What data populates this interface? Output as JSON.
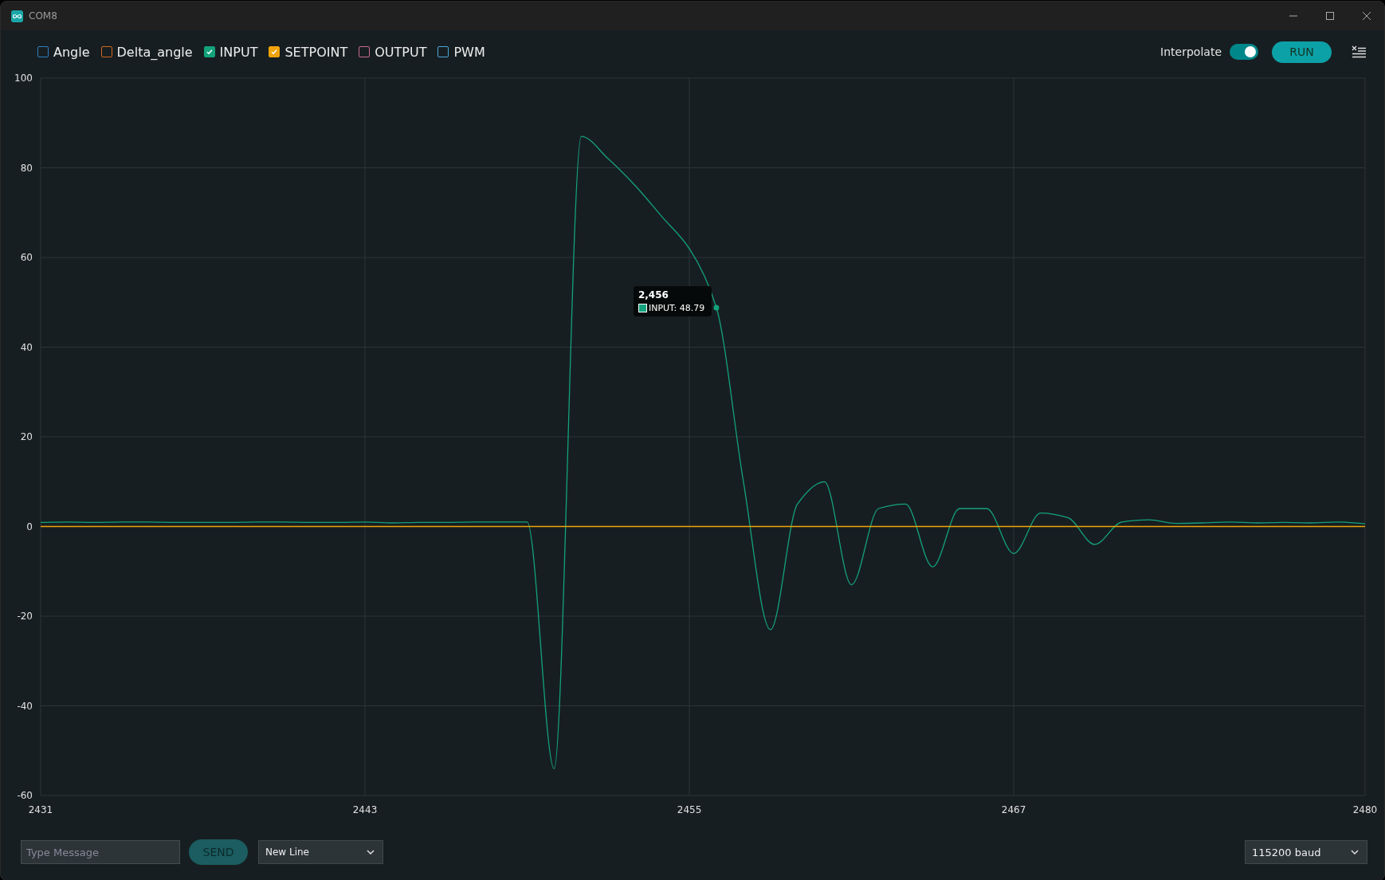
{
  "window": {
    "title": "COM8"
  },
  "legend": [
    {
      "checked": false
    },
    {
      "checked": false
    },
    {
      "checked": true
    },
    {
      "checked": true
    },
    {
      "checked": false
    },
    {
      "checked": false
    }
  ],
  "interpolate": {
    "label": "Interpolate",
    "on": true
  },
  "run_button": "RUN",
  "chart_data": {
    "type": "line",
    "grid": true,
    "x": [
      2431,
      2432,
      2433,
      2434,
      2435,
      2436,
      2437,
      2438,
      2439,
      2440,
      2441,
      2442,
      2443,
      2444,
      2445,
      2446,
      2447,
      2448,
      2449,
      2450,
      2451,
      2452,
      2453,
      2454,
      2455,
      2456,
      2457,
      2458,
      2459,
      2460,
      2461,
      2462,
      2463,
      2464,
      2465,
      2466,
      2467,
      2468,
      2469,
      2470,
      2471,
      2472,
      2473,
      2474,
      2475,
      2476,
      2477,
      2478,
      2479,
      2480
    ],
    "series": [
      {
        "name": "Angle",
        "color": "#2f7fc1",
        "values": [
          null,
          null,
          null,
          null,
          null,
          null,
          null,
          null,
          null,
          null,
          null,
          null,
          null,
          null,
          null,
          null,
          null,
          null,
          null,
          null,
          null,
          null,
          null,
          null,
          null,
          null,
          null,
          null,
          null,
          null,
          null,
          null,
          null,
          null,
          null,
          null,
          null,
          null,
          null,
          null,
          null,
          null,
          null,
          null,
          null,
          null,
          null,
          null,
          null,
          null
        ]
      },
      {
        "name": "Delta_angle",
        "color": "#d0661c",
        "values": [
          null,
          null,
          null,
          null,
          null,
          null,
          null,
          null,
          null,
          null,
          null,
          null,
          null,
          null,
          null,
          null,
          null,
          null,
          null,
          null,
          null,
          null,
          null,
          null,
          null,
          null,
          null,
          null,
          null,
          null,
          null,
          null,
          null,
          null,
          null,
          null,
          null,
          null,
          null,
          null,
          null,
          null,
          null,
          null,
          null,
          null,
          null,
          null,
          null,
          null
        ]
      },
      {
        "name": "INPUT",
        "color": "#13a27c",
        "values": [
          0.9,
          1.0,
          0.9,
          1.0,
          1.0,
          0.9,
          0.9,
          0.9,
          1.0,
          1.0,
          0.9,
          0.9,
          1.0,
          0.8,
          0.9,
          0.9,
          1.0,
          1.0,
          1.0,
          -54,
          87,
          82,
          76,
          69,
          62,
          48.8,
          10,
          -23,
          5,
          10,
          -13,
          4,
          5,
          -9,
          4,
          4,
          -6,
          3,
          2,
          -4,
          1,
          1.5,
          0.7,
          0.8,
          1.0,
          0.8,
          0.9,
          0.8,
          1.0,
          0.6
        ]
      },
      {
        "name": "SETPOINT",
        "color": "#f0a30a",
        "values": [
          0,
          0,
          0,
          0,
          0,
          0,
          0,
          0,
          0,
          0,
          0,
          0,
          0,
          0,
          0,
          0,
          0,
          0,
          0,
          0,
          0,
          0,
          0,
          0,
          0,
          0,
          0,
          0,
          0,
          0,
          0,
          0,
          0,
          0,
          0,
          0,
          0,
          0,
          0,
          0,
          0,
          0,
          0,
          0,
          0,
          0,
          0,
          0,
          0,
          0
        ]
      },
      {
        "name": "OUTPUT",
        "color": "#c76b8f",
        "values": [
          null,
          null,
          null,
          null,
          null,
          null,
          null,
          null,
          null,
          null,
          null,
          null,
          null,
          null,
          null,
          null,
          null,
          null,
          null,
          null,
          null,
          null,
          null,
          null,
          null,
          null,
          null,
          null,
          null,
          null,
          null,
          null,
          null,
          null,
          null,
          null,
          null,
          null,
          null,
          null,
          null,
          null,
          null,
          null,
          null,
          null,
          null,
          null,
          null,
          null
        ]
      },
      {
        "name": "PWM",
        "color": "#4aa6d8",
        "values": [
          null,
          null,
          null,
          null,
          null,
          null,
          null,
          null,
          null,
          null,
          null,
          null,
          null,
          null,
          null,
          null,
          null,
          null,
          null,
          null,
          null,
          null,
          null,
          null,
          null,
          null,
          null,
          null,
          null,
          null,
          null,
          null,
          null,
          null,
          null,
          null,
          null,
          null,
          null,
          null,
          null,
          null,
          null,
          null,
          null,
          null,
          null,
          null,
          null,
          null
        ]
      }
    ],
    "xlim": [
      2431,
      2480
    ],
    "ylim": [
      -60,
      100
    ],
    "xticks": [
      {
        "value": 2431,
        "label": "2431"
      },
      {
        "value": 2443,
        "label": "2443"
      },
      {
        "value": 2455,
        "label": "2455"
      },
      {
        "value": 2467,
        "label": "2467"
      },
      {
        "value": 2480,
        "label": "2480"
      }
    ],
    "yticks": [
      {
        "value": -60,
        "label": "-60"
      },
      {
        "value": -40,
        "label": "-40"
      },
      {
        "value": -20,
        "label": "-20"
      },
      {
        "value": 0,
        "label": "0"
      },
      {
        "value": 20,
        "label": "20"
      },
      {
        "value": 40,
        "label": "40"
      },
      {
        "value": 60,
        "label": "60"
      },
      {
        "value": 80,
        "label": "80"
      },
      {
        "value": 100,
        "label": "100"
      }
    ],
    "annotations": [
      {
        "x": 2456,
        "y": 48.8,
        "text": "INPUT: 48.79"
      }
    ]
  },
  "tooltip": {
    "title": "2,456"
  },
  "message": {
    "placeholder": "Type Message"
  },
  "send_button": "SEND",
  "line_ending": "New Line",
  "baud": "115200 baud"
}
